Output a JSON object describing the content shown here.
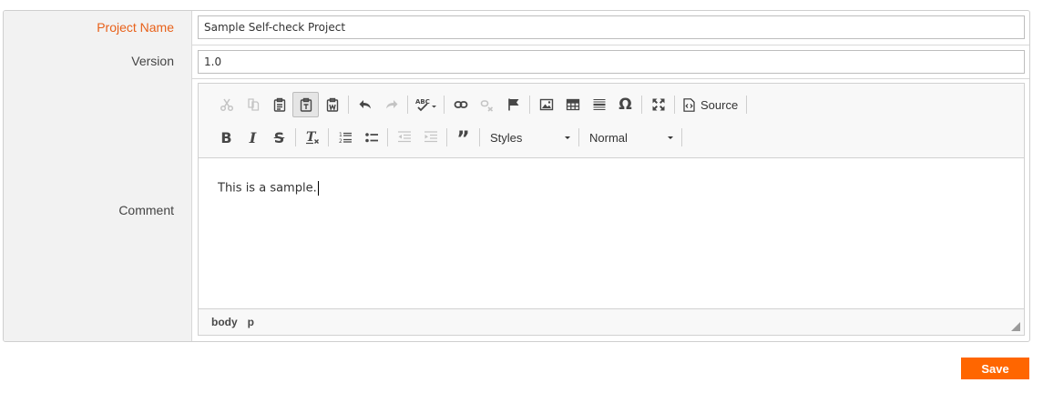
{
  "form": {
    "project_name": {
      "label": "Project Name",
      "value": "Sample Self-check Project",
      "required": true
    },
    "version": {
      "label": "Version",
      "value": "1.0"
    },
    "comment": {
      "label": "Comment",
      "editor": {
        "toolbar_row1": [
          {
            "name": "cut-icon",
            "state": "disabled"
          },
          {
            "name": "copy-icon",
            "state": "disabled"
          },
          {
            "name": "paste-icon",
            "state": "enabled"
          },
          {
            "name": "paste-text-icon",
            "state": "active"
          },
          {
            "name": "paste-from-word-icon",
            "state": "enabled"
          },
          {
            "name": "undo-icon",
            "state": "enabled"
          },
          {
            "name": "redo-icon",
            "state": "disabled"
          },
          {
            "name": "spellcheck-icon",
            "state": "enabled"
          },
          {
            "name": "link-icon",
            "state": "enabled"
          },
          {
            "name": "unlink-icon",
            "state": "disabled"
          },
          {
            "name": "anchor-icon",
            "state": "enabled"
          },
          {
            "name": "image-icon",
            "state": "enabled"
          },
          {
            "name": "table-icon",
            "state": "enabled"
          },
          {
            "name": "horizontal-line-icon",
            "state": "enabled"
          },
          {
            "name": "special-char-icon",
            "state": "enabled"
          },
          {
            "name": "maximize-icon",
            "state": "enabled"
          }
        ],
        "source_label": "Source",
        "toolbar_row2": [
          {
            "name": "bold-icon",
            "state": "enabled"
          },
          {
            "name": "italic-icon",
            "state": "enabled"
          },
          {
            "name": "strikethrough-icon",
            "state": "enabled"
          },
          {
            "name": "remove-format-icon",
            "state": "enabled"
          },
          {
            "name": "numbered-list-icon",
            "state": "enabled"
          },
          {
            "name": "bulleted-list-icon",
            "state": "enabled"
          },
          {
            "name": "decrease-indent-icon",
            "state": "disabled"
          },
          {
            "name": "increase-indent-icon",
            "state": "disabled"
          },
          {
            "name": "blockquote-icon",
            "state": "enabled"
          }
        ],
        "styles_label": "Styles",
        "format_label": "Normal",
        "content_text": "This is a sample.",
        "path": [
          "body",
          "p"
        ]
      }
    }
  },
  "actions": {
    "save_label": "Save"
  },
  "colors": {
    "accent": "#ff6600",
    "required_label": "#e8611a"
  }
}
